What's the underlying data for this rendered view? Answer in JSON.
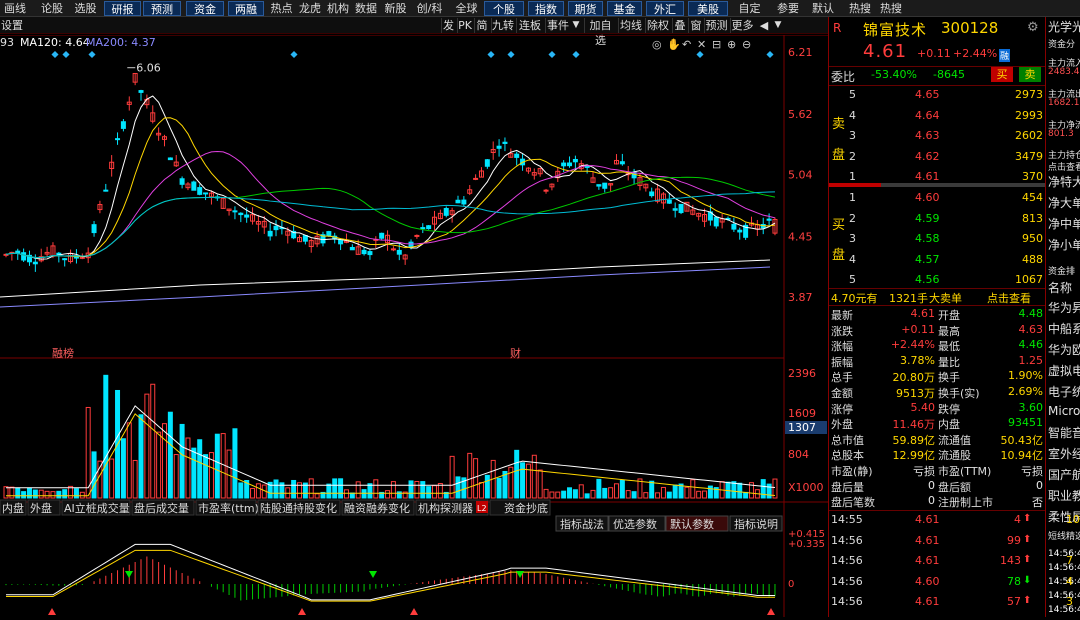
{
  "nav": {
    "items": [
      "画线",
      "论股",
      "选股",
      "研报",
      "预测",
      "资金",
      "两融",
      "热点",
      "龙虎",
      "机构",
      "数据",
      "新股",
      "创/科",
      "全球",
      "个股",
      "指数",
      "期货",
      "基金",
      "外汇",
      "美股",
      "自定",
      "参要",
      "默认",
      "热搜",
      "热搜"
    ]
  },
  "toolbar2": {
    "settings": "设置",
    "buttons": [
      "发",
      "PK",
      "简",
      "九转",
      "连板",
      "事件",
      "加自选",
      "均线",
      "除权",
      "叠",
      "窗",
      "预测",
      "更多"
    ]
  },
  "ma_legend": {
    "prefix": "93",
    "ma120": "MA120: 4.64",
    "ma200": "MA200: 4.37"
  },
  "price_axis": {
    "labels": [
      "6.21",
      "5.62",
      "5.04",
      "4.45",
      "3.87"
    ]
  },
  "max_label": "6.06",
  "event_labels": {
    "a": "融榜",
    "b": "财"
  },
  "vol_axis": {
    "labels": [
      "2396",
      "1609",
      "1307",
      "804",
      "X1000"
    ]
  },
  "vol_tabs": [
    "内盘",
    "外盘",
    "AI立桩成交量",
    "盘后成交量",
    "市盈率(ttm)",
    "陆股通持股变化",
    "融资融券变化",
    "机构探测器",
    "资金抄底"
  ],
  "vol_tab_badge": "L2",
  "ind_tabs": [
    "指标战法",
    "优选参数",
    "默认参数",
    "指标说明"
  ],
  "ind_axis": {
    "labels": [
      "+0.415",
      "+0.335",
      "0"
    ]
  },
  "colors": {
    "up": "#ff3c3c",
    "down": "#00e5ff",
    "yellow": "#ffd700",
    "white": "#ffffff",
    "magenta": "#e040e0",
    "green": "#00c800"
  },
  "stock": {
    "r": "R",
    "name": "锦富技术",
    "code": "300128",
    "price": "4.61",
    "change": "+0.11",
    "pct": "+2.44%",
    "badge": "融",
    "weibi_label": "委比",
    "weibi": "-53.40%",
    "weicha": "-8645",
    "buy_btn": "买",
    "sell_btn": "卖"
  },
  "asks": [
    {
      "n": "5",
      "p": "4.65",
      "v": "2973"
    },
    {
      "n": "4",
      "p": "4.64",
      "v": "2993"
    },
    {
      "n": "3",
      "p": "4.63",
      "v": "2602"
    },
    {
      "n": "2",
      "p": "4.62",
      "v": "3479"
    },
    {
      "n": "1",
      "p": "4.61",
      "v": "370"
    }
  ],
  "bids": [
    {
      "n": "1",
      "p": "4.60",
      "v": "454"
    },
    {
      "n": "2",
      "p": "4.59",
      "v": "813"
    },
    {
      "n": "3",
      "p": "4.58",
      "v": "950"
    },
    {
      "n": "4",
      "p": "4.57",
      "v": "488"
    },
    {
      "n": "5",
      "p": "4.56",
      "v": "1067"
    }
  ],
  "ask_side": [
    "卖",
    "盘"
  ],
  "bid_side": [
    "买",
    "盘"
  ],
  "bigorder": {
    "price": "4.70元有",
    "vol": "1321手",
    "label": "大卖单",
    "link": "点击查看"
  },
  "stats": [
    {
      "l": "最新",
      "v": "4.61",
      "vc": "red",
      "l2": "开盘",
      "v2": "4.48",
      "v2c": "green"
    },
    {
      "l": "涨跌",
      "v": "+0.11",
      "vc": "red",
      "l2": "最高",
      "v2": "4.63",
      "v2c": "red"
    },
    {
      "l": "涨幅",
      "v": "+2.44%",
      "vc": "red",
      "l2": "最低",
      "v2": "4.46",
      "v2c": "green"
    },
    {
      "l": "振幅",
      "v": "3.78%",
      "vc": "yel",
      "l2": "量比",
      "v2": "1.25",
      "v2c": "red"
    },
    {
      "l": "总手",
      "v": "20.80万",
      "vc": "yel",
      "l2": "换手",
      "v2": "1.90%",
      "v2c": "yel"
    },
    {
      "l": "金额",
      "v": "9513万",
      "vc": "yel",
      "l2": "换手(实)",
      "v2": "2.69%",
      "v2c": "yel"
    },
    {
      "l": "涨停",
      "v": "5.40",
      "vc": "red",
      "l2": "跌停",
      "v2": "3.60",
      "v2c": "green"
    },
    {
      "l": "外盘",
      "v": "11.46万",
      "vc": "red",
      "l2": "内盘",
      "v2": "93451",
      "v2c": "green"
    },
    {
      "l": "总市值",
      "v": "59.89亿",
      "vc": "yel",
      "l2": "流通值",
      "v2": "50.43亿",
      "v2c": "yel"
    },
    {
      "l": "总股本",
      "v": "12.99亿",
      "vc": "yel",
      "l2": "流通股",
      "v2": "10.94亿",
      "v2c": "yel"
    },
    {
      "l": "市盈(静)",
      "v": "亏损",
      "vc": "wht",
      "l2": "市盈(TTM)",
      "v2": "亏损",
      "v2c": "wht"
    },
    {
      "l": "盘后量",
      "v": "0",
      "vc": "wht",
      "l2": "盘后额",
      "v2": "0",
      "v2c": "wht"
    },
    {
      "l": "盘后笔数",
      "v": "0",
      "vc": "wht",
      "l2": "注册制上市",
      "v2": "否",
      "v2c": "wht"
    }
  ],
  "ticks": [
    {
      "t": "14:55",
      "p": "4.61",
      "pc": "red",
      "v": "4",
      "d": "up"
    },
    {
      "t": "14:56",
      "p": "4.61",
      "pc": "red",
      "v": "99",
      "d": "up"
    },
    {
      "t": "14:56",
      "p": "4.61",
      "pc": "red",
      "v": "143",
      "d": "up"
    },
    {
      "t": "14:56",
      "p": "4.60",
      "pc": "red",
      "v": "78",
      "d": "down"
    },
    {
      "t": "14:56",
      "p": "4.61",
      "pc": "red",
      "v": "57",
      "d": "up"
    }
  ],
  "farright": {
    "items": [
      "光学光",
      "资金分",
      "主力流入",
      "2483.4",
      "主力流出",
      "1682.1",
      "主力净流",
      "801.3",
      "主力持仓",
      "点击查看",
      "净特大",
      "净大单",
      "净中单",
      "净小单",
      "资金排",
      "名称",
      "华为昇",
      "中船系",
      "华为欧",
      "虚拟电",
      "电子统",
      "MicroL",
      "智能音",
      "室外经",
      "国产航",
      "职业教",
      "柔性屏",
      "短线精选",
      "14:56:4",
      "14:56:4",
      "14:56:4",
      "14:56:4",
      "14:56:4"
    ],
    "digits": [
      "10",
      "7",
      "4",
      "3"
    ]
  }
}
